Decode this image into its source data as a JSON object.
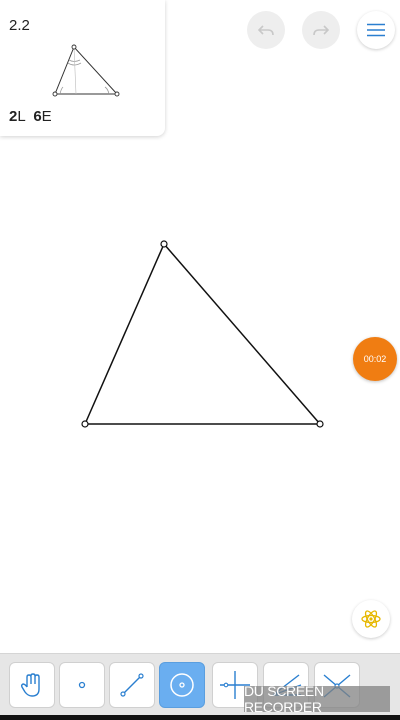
{
  "level": {
    "number": "2.2",
    "score_l_value": "2",
    "score_l_unit": "L",
    "score_e_value": "6",
    "score_e_unit": "E"
  },
  "header": {
    "undo_icon": "undo-icon",
    "redo_icon": "redo-icon",
    "menu_icon": "hamburger-menu-icon"
  },
  "timer": {
    "label": "00:02",
    "color": "#f07d12"
  },
  "hint": {
    "icon": "atom-hint-icon",
    "color": "#e6b800"
  },
  "toolbar": {
    "tools": [
      {
        "name": "hand-tool",
        "icon": "hand-icon",
        "active": false
      },
      {
        "name": "point-tool",
        "icon": "point-icon",
        "active": false
      },
      {
        "name": "line-tool",
        "icon": "line-segment-icon",
        "active": false
      },
      {
        "name": "circle-tool",
        "icon": "circle-icon",
        "active": true
      },
      {
        "name": "perpendicular-tool",
        "icon": "perpendicular-icon",
        "active": false
      },
      {
        "name": "angle-bisector-tool",
        "icon": "angle-bisector-icon",
        "active": false
      },
      {
        "name": "intersection-tool",
        "icon": "intersection-icon",
        "active": false
      }
    ],
    "active_color": "#6aaef0"
  },
  "watermark": {
    "text": "DU SCREEN RECORDER"
  }
}
